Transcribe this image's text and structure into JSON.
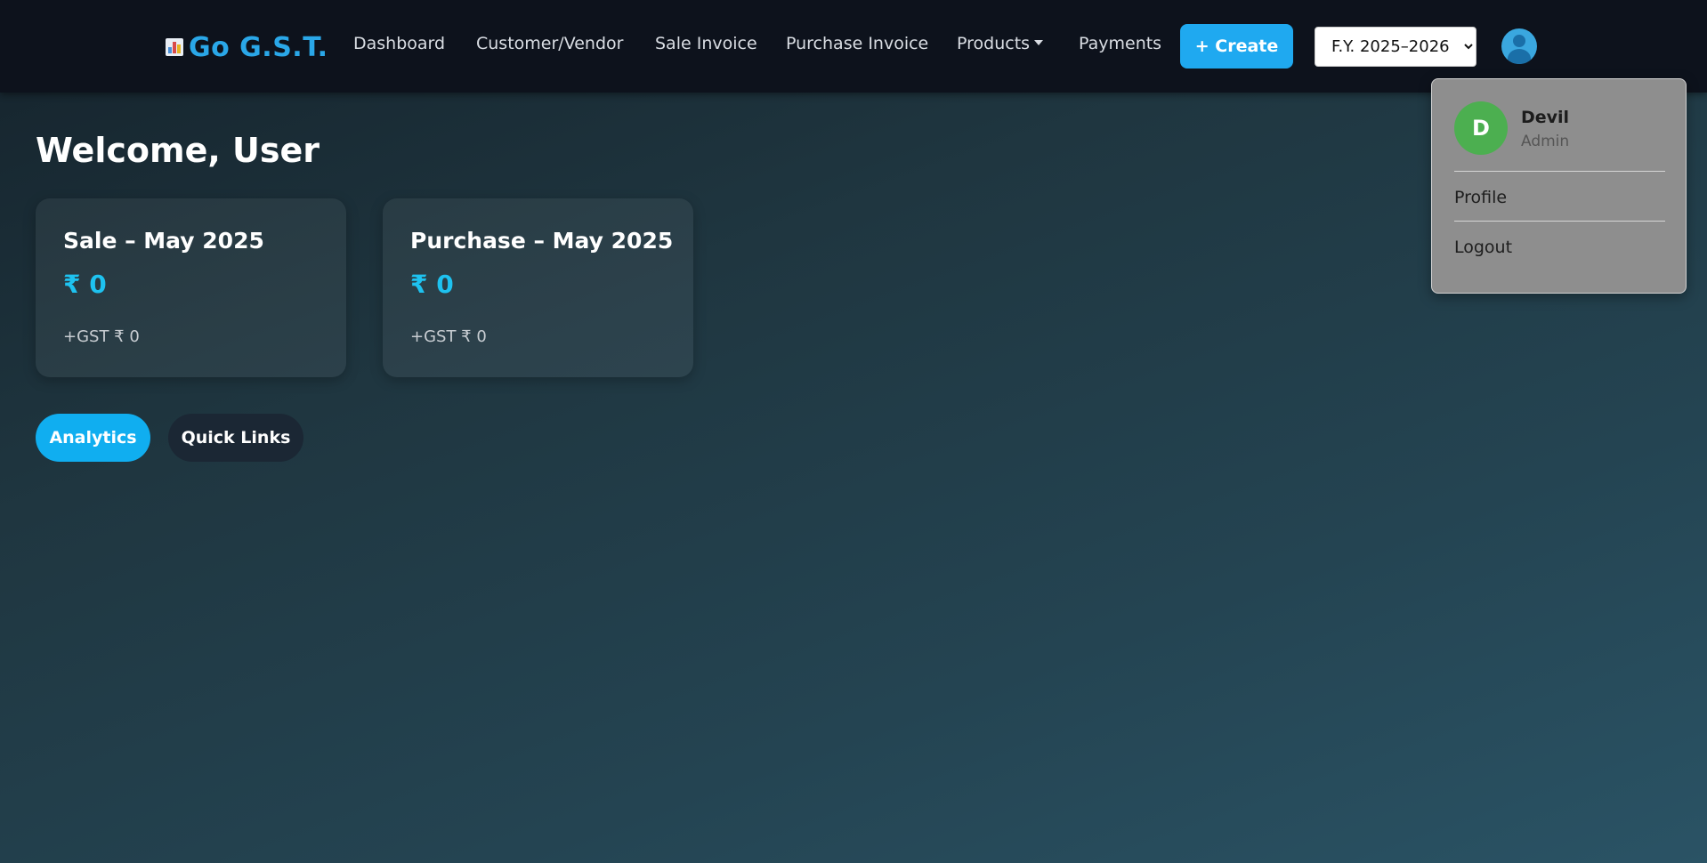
{
  "navbar": {
    "brand": "Go G.S.T.",
    "brand_icon": "bar-chart-icon",
    "links": {
      "dashboard": "Dashboard",
      "customer_vendor": "Customer/Vendor",
      "sale_invoice": "Sale Invoice",
      "purchase_invoice": "Purchase Invoice",
      "products": "Products",
      "payments": "Payments"
    },
    "create_label": "+ Create",
    "fiscal_year": {
      "selected": "F.Y. 2025–2026",
      "options": [
        "F.Y. 2025–2026"
      ]
    },
    "avatar_icon": "user-icon"
  },
  "user_menu": {
    "initial": "D",
    "name": "Devil",
    "role": "Admin",
    "items": [
      "Profile",
      "Logout"
    ]
  },
  "main": {
    "welcome": "Welcome, User",
    "cards": [
      {
        "title": "Sale – May 2025",
        "amount": "₹ 0",
        "gst": "+GST ₹ 0"
      },
      {
        "title": "Purchase – May 2025",
        "amount": "₹ 0",
        "gst": "+GST ₹ 0"
      }
    ],
    "tabs": [
      "Analytics",
      "Quick Links"
    ]
  },
  "colors": {
    "accent": "#1fa9f0",
    "amount": "#1ec2f0",
    "avatar_green": "#4caf50",
    "navbar_bg": "#0d121c"
  }
}
